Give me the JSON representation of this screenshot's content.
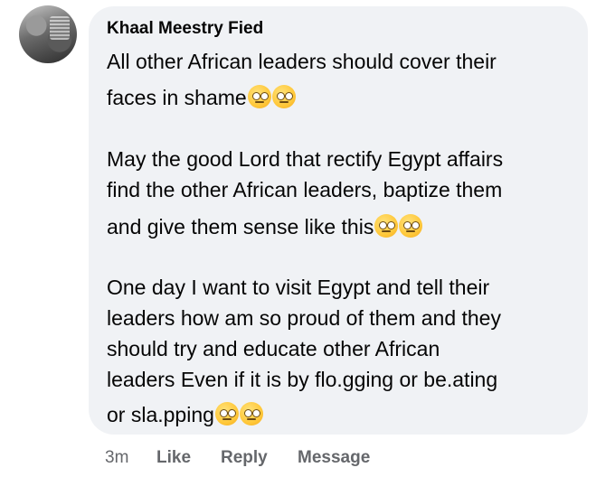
{
  "comment": {
    "author": "Khaal Meestry Fied",
    "lines": [
      "All other African leaders should cover their",
      "faces in shame",
      "May the good Lord that rectify Egypt affairs",
      "find the other African leaders, baptize them",
      "and give them sense like this",
      "One day I want to visit Egypt and tell their",
      "leaders how am so proud of them and they",
      "should try and educate other African",
      "leaders Even if it is by flo.gging or be.ating",
      "or sla.pping"
    ]
  },
  "footer": {
    "time": "3m",
    "like": "Like",
    "reply": "Reply",
    "message": "Message"
  },
  "colors": {
    "bubble": "#f0f2f5",
    "meta": "#65676b",
    "text": "#050505"
  },
  "icons": [
    "rolling-eyes-emoji",
    "sad-relieved-emoji",
    "unamused-emoji",
    "raised-eyebrow-emoji"
  ]
}
